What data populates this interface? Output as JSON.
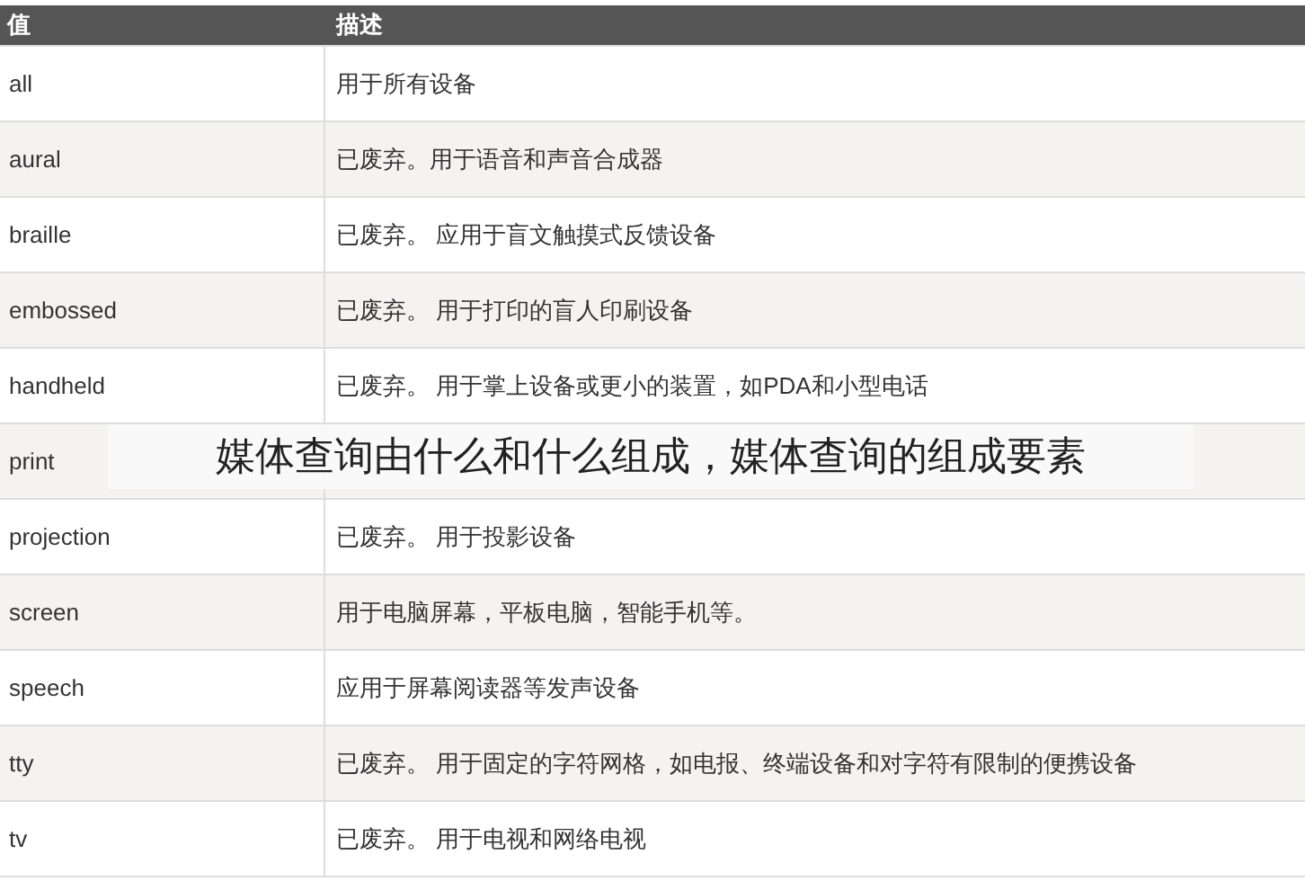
{
  "table": {
    "columns": [
      "值",
      "描述"
    ],
    "rows": [
      {
        "value": "all",
        "description": "用于所有设备"
      },
      {
        "value": "aural",
        "description": "已废弃。用于语音和声音合成器"
      },
      {
        "value": "braille",
        "description": "已废弃。 应用于盲文触摸式反馈设备"
      },
      {
        "value": "embossed",
        "description": "已废弃。 用于打印的盲人印刷设备"
      },
      {
        "value": "handheld",
        "description": "已废弃。 用于掌上设备或更小的装置，如PDA和小型电话"
      },
      {
        "value": "print"
      },
      {
        "value": "projection",
        "description": "已废弃。 用于投影设备"
      },
      {
        "value": "screen",
        "description": "用于电脑屏幕，平板电脑，智能手机等。"
      },
      {
        "value": "speech",
        "description": "应用于屏幕阅读器等发声设备"
      },
      {
        "value": "tty",
        "description": "已废弃。 用于固定的字符网格，如电报、终端设备和对字符有限制的便携设备"
      },
      {
        "value": "tv",
        "description": "已废弃。 用于电视和网络电视"
      }
    ]
  },
  "caption": "媒体查询由什么和什么组成，媒体查询的组成要素"
}
